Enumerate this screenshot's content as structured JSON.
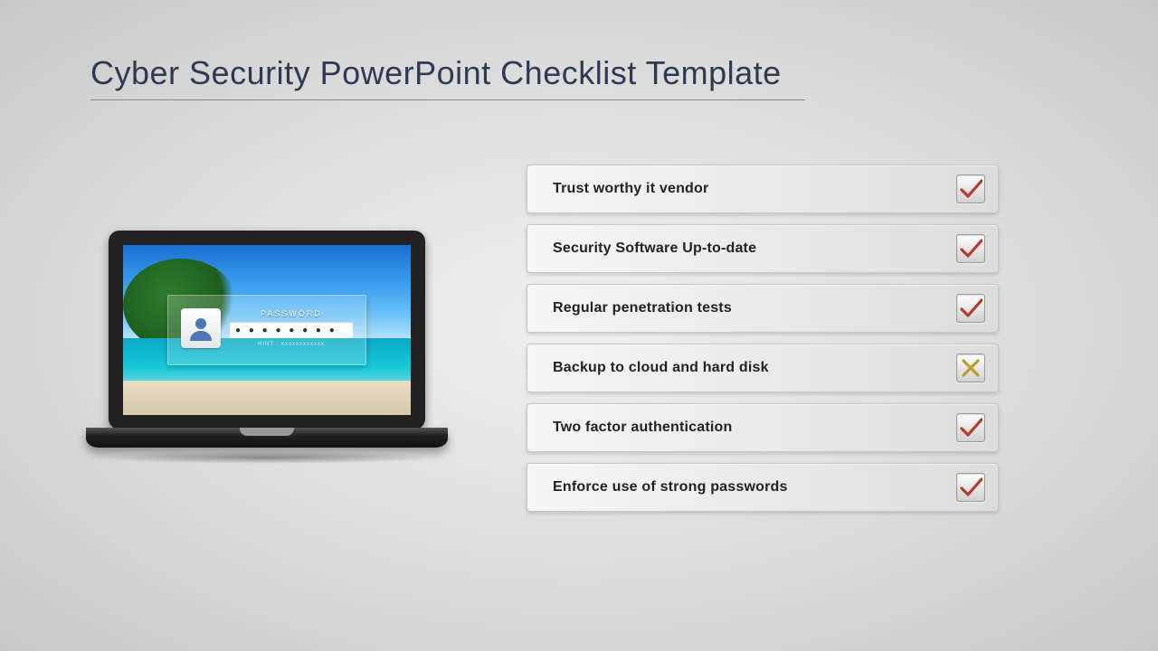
{
  "title": "Cyber Security PowerPoint Checklist Template",
  "login": {
    "password_label": "PASSWORD",
    "password_mask": "● ● ● ● ● ● ● ●",
    "hint": "HINT : xxxxxxxxxxxx"
  },
  "checklist": [
    {
      "label": "Trust worthy it vendor",
      "status": "check"
    },
    {
      "label": "Security Software Up-to-date",
      "status": "check"
    },
    {
      "label": "Regular penetration tests",
      "status": "check"
    },
    {
      "label": "Backup to cloud and hard disk",
      "status": "cross"
    },
    {
      "label": "Two factor authentication",
      "status": "check"
    },
    {
      "label": "Enforce use of strong passwords",
      "status": "check"
    }
  ],
  "icons": {
    "check_color": "#b53a2a",
    "cross_color": "#b9a02a"
  }
}
